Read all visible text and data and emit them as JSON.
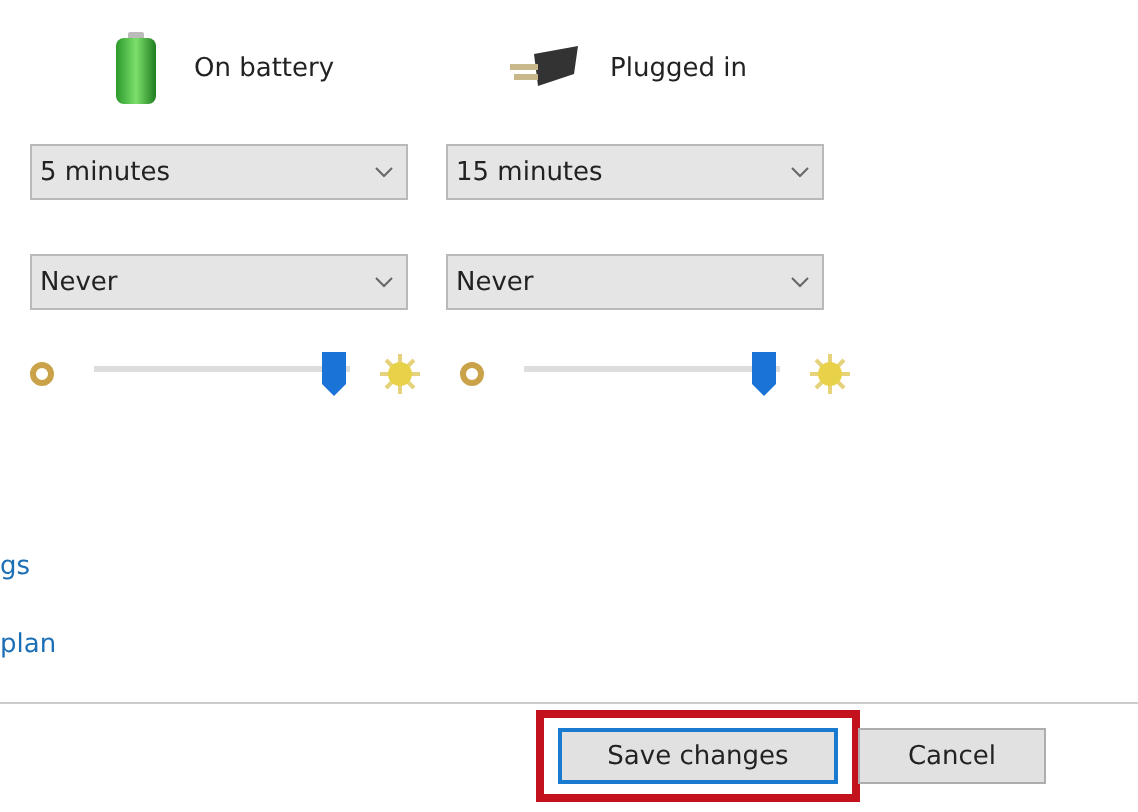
{
  "columns": [
    {
      "label": "On battery",
      "kind": "battery"
    },
    {
      "label": "Plugged in",
      "kind": "plug"
    }
  ],
  "settings": [
    {
      "kind": "dropdown",
      "values": [
        "5 minutes",
        "15 minutes"
      ]
    },
    {
      "kind": "dropdown",
      "values": [
        "Never",
        "Never"
      ]
    },
    {
      "kind": "slider",
      "sliders": [
        {
          "level": 0.94
        },
        {
          "level": 0.94
        }
      ]
    }
  ],
  "links": [
    "gs",
    "plan"
  ],
  "buttons": [
    {
      "label": "Save changes",
      "highlighted": true,
      "focused": true
    },
    {
      "label": "Cancel",
      "highlighted": false,
      "focused": false
    }
  ]
}
